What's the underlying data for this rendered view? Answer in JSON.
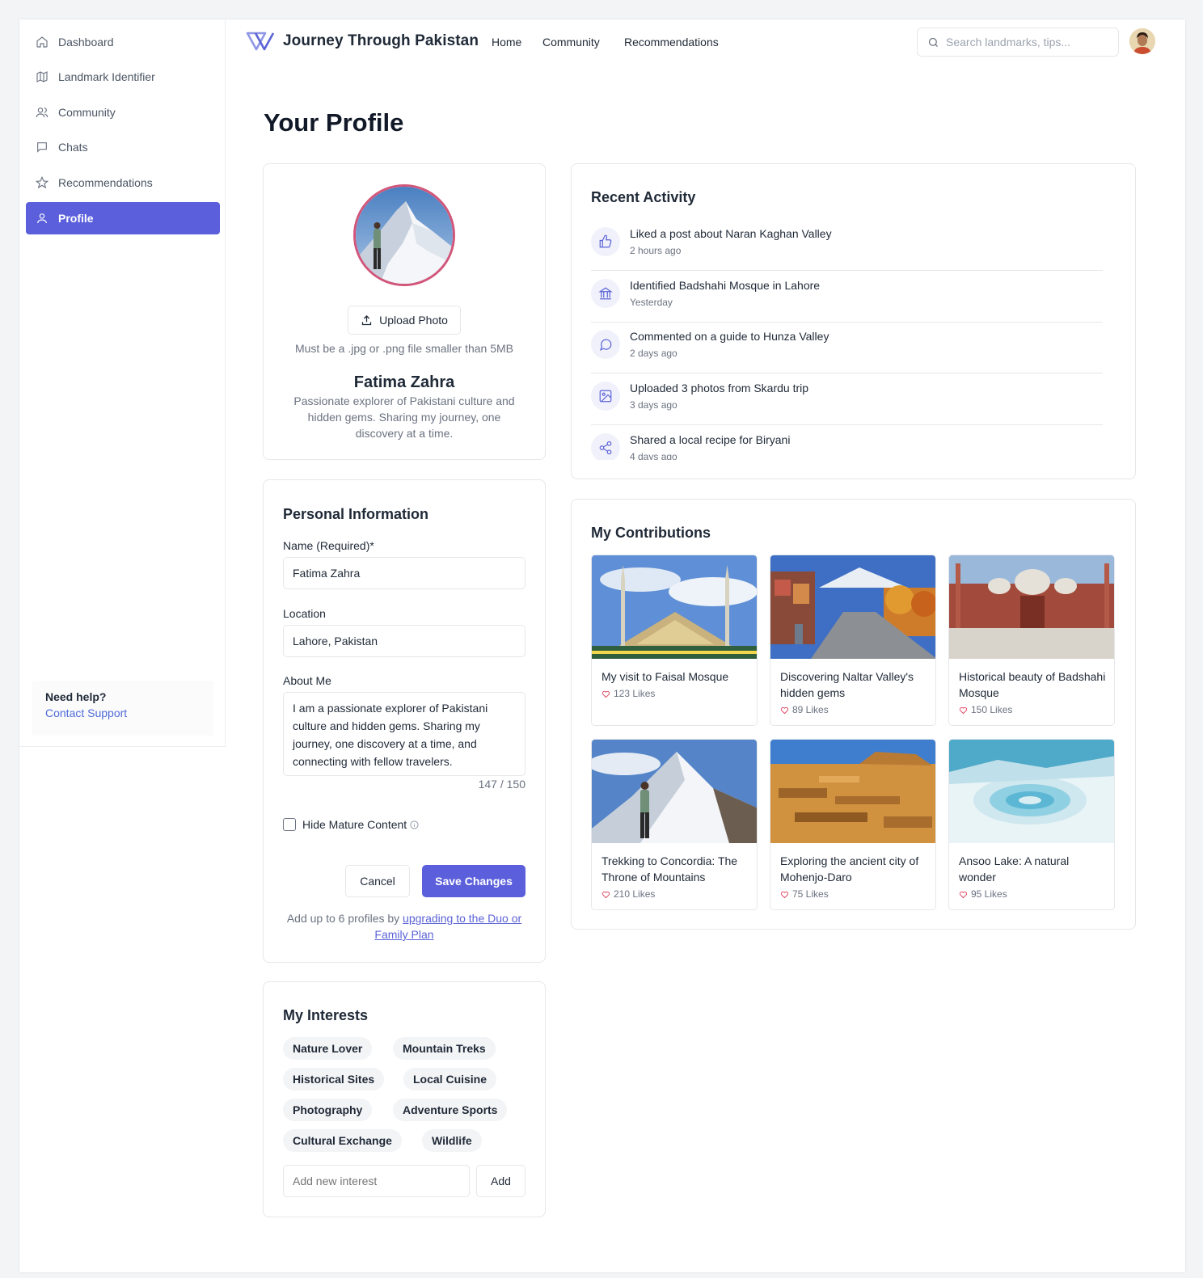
{
  "sidebar": {
    "items": [
      {
        "label": "Dashboard",
        "icon": "home-icon"
      },
      {
        "label": "Landmark Identifier",
        "icon": "map-icon"
      },
      {
        "label": "Community",
        "icon": "users-icon"
      },
      {
        "label": "Chats",
        "icon": "chat-icon"
      },
      {
        "label": "Recommendations",
        "icon": "star-icon"
      },
      {
        "label": "Profile",
        "icon": "user-icon",
        "active": true
      }
    ],
    "help_title": "Need help?",
    "help_link": "Contact Support"
  },
  "header": {
    "brand": "Journey Through Pakistan",
    "nav": [
      "Home",
      "Community",
      "Recommendations"
    ],
    "search_placeholder": "Search landmarks, tips..."
  },
  "page_title": "Your Profile",
  "profile": {
    "upload_label": "Upload Photo",
    "upload_hint": "Must be a .jpg or .png file smaller than 5MB",
    "name": "Fatima Zahra",
    "bio": "Passionate explorer of Pakistani culture and hidden gems. Sharing my journey, one discovery at a time."
  },
  "personal_info": {
    "title": "Personal Information",
    "name_label": "Name (Required)*",
    "name_value": "Fatima Zahra",
    "location_label": "Location",
    "location_value": "Lahore, Pakistan",
    "about_label": "About Me",
    "about_value": "I am a passionate explorer of Pakistani culture and hidden gems. Sharing my journey, one discovery at a time, and connecting with fellow travelers.",
    "char_count": "147 / 150",
    "hide_mature_label": "Hide Mature Content",
    "hide_mature_checked": false,
    "cancel_label": "Cancel",
    "save_label": "Save Changes",
    "upgrade_prefix": "Add up to 6 profiles by",
    "upgrade_link": "upgrading to the Duo or Family Plan"
  },
  "interests": {
    "title": "My Interests",
    "items": [
      "Nature Lover",
      "Mountain Treks",
      "Historical Sites",
      "Local Cuisine",
      "Photography",
      "Adventure Sports",
      "Cultural Exchange",
      "Wildlife"
    ],
    "input_placeholder": "Add new interest",
    "add_label": "Add"
  },
  "activity": {
    "title": "Recent Activity",
    "items": [
      {
        "text": "Liked a post about Naran Kaghan Valley",
        "time": "2 hours ago",
        "icon": "thumbs-up-icon"
      },
      {
        "text": "Identified Badshahi Mosque in Lahore",
        "time": "Yesterday",
        "icon": "landmark-icon"
      },
      {
        "text": "Commented on a guide to Hunza Valley",
        "time": "2 days ago",
        "icon": "comment-icon"
      },
      {
        "text": "Uploaded 3 photos from Skardu trip",
        "time": "3 days ago",
        "icon": "image-icon"
      },
      {
        "text": "Shared a local recipe for Biryani",
        "time": "4 days ago",
        "icon": "share-icon"
      }
    ]
  },
  "contributions": {
    "title": "My Contributions",
    "items": [
      {
        "title": "My visit to Faisal Mosque",
        "likes": "123 Likes"
      },
      {
        "title": "Discovering Naltar Valley's hidden gems",
        "likes": "89 Likes"
      },
      {
        "title": "Historical beauty of Badshahi Mosque",
        "likes": "150 Likes"
      },
      {
        "title": "Trekking to Concordia: The Throne of Mountains",
        "likes": "210 Likes"
      },
      {
        "title": "Exploring the ancient city of Mohenjo-Daro",
        "likes": "75 Likes"
      },
      {
        "title": "Ansoo Lake: A natural wonder",
        "likes": "95 Likes"
      }
    ]
  },
  "colors": {
    "accent": "#5b5fdb",
    "link": "#4f6bd8",
    "like": "#e0415d",
    "photo_ring": "#d2567a"
  }
}
